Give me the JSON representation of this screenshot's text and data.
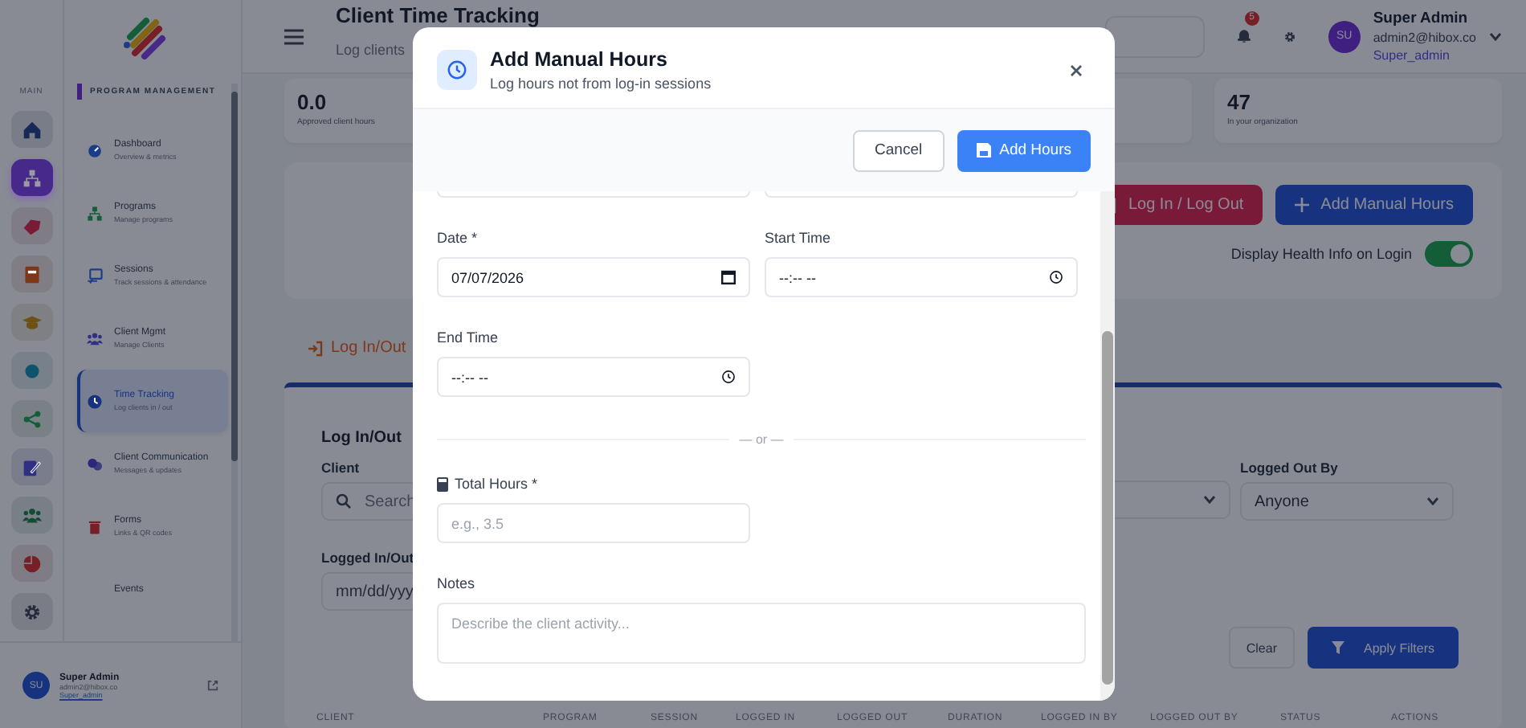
{
  "sidebar_rail": {
    "label": "MAIN",
    "items": [
      {
        "kind": "home",
        "color": "#172958",
        "selected": false
      },
      {
        "kind": "sitemap",
        "color": "#46298a",
        "selected": true
      },
      {
        "kind": "tag",
        "color": "#791a37",
        "selected": false
      },
      {
        "kind": "book",
        "color": "#7d3819",
        "selected": false
      },
      {
        "kind": "cap",
        "color": "#6d5115",
        "selected": false
      },
      {
        "kind": "dot",
        "color": "#0c546c",
        "selected": false
      },
      {
        "kind": "share",
        "color": "#135d38",
        "selected": false
      },
      {
        "kind": "edit",
        "color": "#302f86",
        "selected": false
      },
      {
        "kind": "people",
        "color": "#134c32",
        "selected": false
      },
      {
        "kind": "pie",
        "color": "#761f26",
        "selected": false
      },
      {
        "kind": "gear",
        "color": "#242c3c",
        "selected": false
      }
    ]
  },
  "nav": {
    "section": "PROGRAM MANAGEMENT",
    "items": [
      {
        "title": "Dashboard",
        "subtitle": "Overview & metrics",
        "kind": "gauge",
        "color": "#1b3d89",
        "selected": false
      },
      {
        "title": "Programs",
        "subtitle": "Manage programs",
        "kind": "sitemap",
        "color": "#135d38",
        "selected": false
      },
      {
        "title": "Sessions",
        "subtitle": "Track sessions & attendance",
        "kind": "screen",
        "color": "#1b3d89",
        "selected": false
      },
      {
        "title": "Client Mgmt",
        "subtitle": "Manage Clients",
        "kind": "people",
        "color": "#302f86",
        "selected": false
      },
      {
        "title": "Time Tracking",
        "subtitle": "Log clients in / out",
        "kind": "clock",
        "color": "#17337f",
        "selected": true
      },
      {
        "title": "Client Communication",
        "subtitle": "Messages & updates",
        "kind": "chat",
        "color": "#2a2878",
        "selected": false
      },
      {
        "title": "Forms",
        "subtitle": "Links & QR codes",
        "kind": "trash",
        "color": "#761f26",
        "selected": false
      },
      {
        "title": "Events",
        "kind": "none",
        "selected": false
      }
    ]
  },
  "sidebar_user": {
    "initials": "SU",
    "name": "Super Admin",
    "email": "admin2@hibox.co",
    "role": "Super_admin"
  },
  "header": {
    "title": "Client Time Tracking",
    "subtitle": "Log clients",
    "notification_count": "5",
    "user": {
      "initials": "SU",
      "name": "Super Admin",
      "email": "admin2@hibox.co",
      "role": "Super_admin"
    }
  },
  "stats": [
    {
      "value": "0.0",
      "caption": "Approved client hours"
    },
    {
      "value": "47",
      "caption": "In your organization"
    }
  ],
  "actions": {
    "buttons": [
      {
        "label": "Log In / Log Out",
        "kind": "login"
      },
      {
        "label": "Add Manual Hours",
        "kind": "add"
      }
    ],
    "toggle": {
      "label": "Display Health Info on Login",
      "on": true
    }
  },
  "tab": {
    "label": "Log In/Out"
  },
  "filters": {
    "title": "Log In/Out",
    "client_label": "Client",
    "client_placeholder": "Search",
    "date_label": "Logged In/Out",
    "date_placeholder": "mm/dd/yyy",
    "logged_out_by_label": "Logged Out By",
    "logged_out_by_value": "Anyone",
    "clear": "Clear",
    "apply": "Apply Filters"
  },
  "table": {
    "columns": [
      "CLIENT",
      "PROGRAM",
      "SESSION",
      "LOGGED IN",
      "LOGGED OUT",
      "DURATION",
      "LOGGED IN BY",
      "LOGGED OUT BY",
      "STATUS",
      "ACTIONS"
    ]
  },
  "modal": {
    "title": "Add Manual Hours",
    "subtitle": "Log hours not from log-in sessions",
    "cancel": "Cancel",
    "submit": "Add Hours",
    "date": {
      "label": "Date *",
      "value": "07/07/2026"
    },
    "start_time": {
      "label": "Start Time",
      "value": "--:-- --"
    },
    "end_time": {
      "label": "End Time",
      "value": "--:-- --"
    },
    "divider": "— or —",
    "total_hours": {
      "label": "Total Hours *",
      "placeholder": "e.g., 3.5"
    },
    "notes": {
      "label": "Notes",
      "placeholder": "Describe the client activity..."
    }
  }
}
